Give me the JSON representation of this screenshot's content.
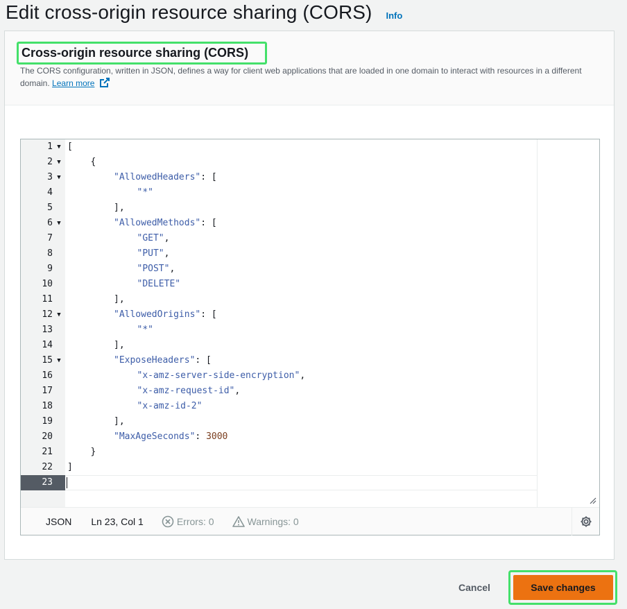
{
  "page": {
    "title": "Edit cross-origin resource sharing (CORS)",
    "info_label": "Info"
  },
  "section": {
    "title": "Cross-origin resource sharing (CORS)",
    "description": "The CORS configuration, written in JSON, defines a way for client web applications that are loaded in one domain to interact with resources in a different domain.",
    "learn_more": "Learn more"
  },
  "editor": {
    "lines": [
      {
        "n": "1",
        "fold": true,
        "indent": 0,
        "parts": [
          {
            "t": "[",
            "c": "p"
          }
        ]
      },
      {
        "n": "2",
        "fold": true,
        "indent": 1,
        "parts": [
          {
            "t": "{",
            "c": "p"
          }
        ]
      },
      {
        "n": "3",
        "fold": true,
        "indent": 2,
        "parts": [
          {
            "t": "\"AllowedHeaders\"",
            "c": "s"
          },
          {
            "t": ": [",
            "c": "p"
          }
        ]
      },
      {
        "n": "4",
        "fold": false,
        "indent": 3,
        "parts": [
          {
            "t": "\"*\"",
            "c": "s"
          }
        ]
      },
      {
        "n": "5",
        "fold": false,
        "indent": 2,
        "parts": [
          {
            "t": "],",
            "c": "p"
          }
        ]
      },
      {
        "n": "6",
        "fold": true,
        "indent": 2,
        "parts": [
          {
            "t": "\"AllowedMethods\"",
            "c": "s"
          },
          {
            "t": ": [",
            "c": "p"
          }
        ]
      },
      {
        "n": "7",
        "fold": false,
        "indent": 3,
        "parts": [
          {
            "t": "\"GET\"",
            "c": "s"
          },
          {
            "t": ",",
            "c": "p"
          }
        ]
      },
      {
        "n": "8",
        "fold": false,
        "indent": 3,
        "parts": [
          {
            "t": "\"PUT\"",
            "c": "s"
          },
          {
            "t": ",",
            "c": "p"
          }
        ]
      },
      {
        "n": "9",
        "fold": false,
        "indent": 3,
        "parts": [
          {
            "t": "\"POST\"",
            "c": "s"
          },
          {
            "t": ",",
            "c": "p"
          }
        ]
      },
      {
        "n": "10",
        "fold": false,
        "indent": 3,
        "parts": [
          {
            "t": "\"DELETE\"",
            "c": "s"
          }
        ]
      },
      {
        "n": "11",
        "fold": false,
        "indent": 2,
        "parts": [
          {
            "t": "],",
            "c": "p"
          }
        ]
      },
      {
        "n": "12",
        "fold": true,
        "indent": 2,
        "parts": [
          {
            "t": "\"AllowedOrigins\"",
            "c": "s"
          },
          {
            "t": ": [",
            "c": "p"
          }
        ]
      },
      {
        "n": "13",
        "fold": false,
        "indent": 3,
        "parts": [
          {
            "t": "\"*\"",
            "c": "s"
          }
        ]
      },
      {
        "n": "14",
        "fold": false,
        "indent": 2,
        "parts": [
          {
            "t": "],",
            "c": "p"
          }
        ]
      },
      {
        "n": "15",
        "fold": true,
        "indent": 2,
        "parts": [
          {
            "t": "\"ExposeHeaders\"",
            "c": "s"
          },
          {
            "t": ": [",
            "c": "p"
          }
        ]
      },
      {
        "n": "16",
        "fold": false,
        "indent": 3,
        "parts": [
          {
            "t": "\"x-amz-server-side-encryption\"",
            "c": "s"
          },
          {
            "t": ",",
            "c": "p"
          }
        ]
      },
      {
        "n": "17",
        "fold": false,
        "indent": 3,
        "parts": [
          {
            "t": "\"x-amz-request-id\"",
            "c": "s"
          },
          {
            "t": ",",
            "c": "p"
          }
        ]
      },
      {
        "n": "18",
        "fold": false,
        "indent": 3,
        "parts": [
          {
            "t": "\"x-amz-id-2\"",
            "c": "s"
          }
        ]
      },
      {
        "n": "19",
        "fold": false,
        "indent": 2,
        "parts": [
          {
            "t": "],",
            "c": "p"
          }
        ]
      },
      {
        "n": "20",
        "fold": false,
        "indent": 2,
        "parts": [
          {
            "t": "\"MaxAgeSeconds\"",
            "c": "s"
          },
          {
            "t": ": ",
            "c": "p"
          },
          {
            "t": "3000",
            "c": "n"
          }
        ]
      },
      {
        "n": "21",
        "fold": false,
        "indent": 1,
        "parts": [
          {
            "t": "}",
            "c": "p"
          }
        ]
      },
      {
        "n": "22",
        "fold": false,
        "indent": 0,
        "parts": [
          {
            "t": "]",
            "c": "p"
          }
        ]
      },
      {
        "n": "23",
        "fold": false,
        "indent": 0,
        "active": true,
        "parts": []
      }
    ],
    "status": {
      "language": "JSON",
      "position": "Ln 23, Col 1",
      "errors": "Errors: 0",
      "warnings": "Warnings: 0"
    }
  },
  "actions": {
    "cancel": "Cancel",
    "save": "Save changes"
  },
  "colors": {
    "accent": "#ec7211",
    "highlight_outline": "#44e06a",
    "link": "#0073bb"
  }
}
